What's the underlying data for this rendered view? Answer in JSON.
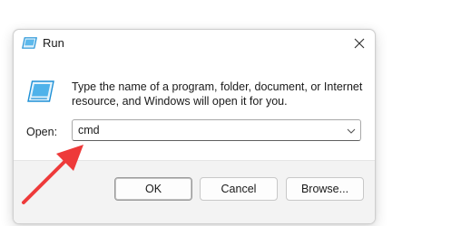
{
  "window": {
    "title": "Run",
    "close_icon": "close-icon",
    "app_icon": "run-icon"
  },
  "body": {
    "description": "Type the name of a program, folder, document, or Internet resource, and Windows will open it for you.",
    "open_label": "Open:",
    "open_value": "cmd",
    "dropdown_icon": "chevron-down-icon"
  },
  "buttons": {
    "ok": "OK",
    "cancel": "Cancel",
    "browse": "Browse..."
  },
  "colors": {
    "annotation_arrow": "#ee3a3a",
    "icon_blue": "#1e90d6"
  }
}
